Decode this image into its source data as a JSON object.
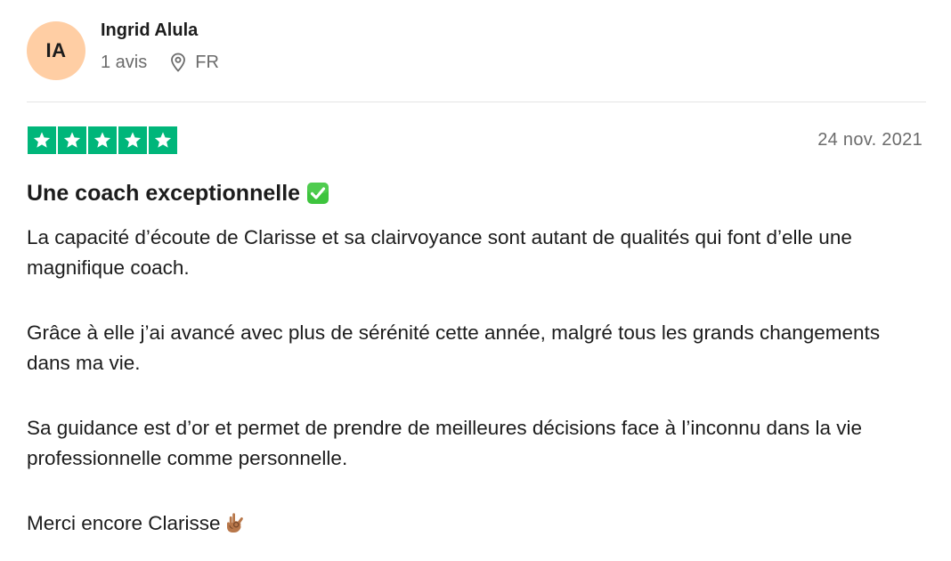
{
  "reviewer": {
    "initials": "IA",
    "avatar_color": "#ffcea4",
    "name": "Ingrid Alula",
    "reviews_count": "1 avis",
    "location_icon": "location-pin-icon",
    "country": "FR"
  },
  "review": {
    "rating": 5,
    "rating_max": 5,
    "star_color": "#00b67a",
    "date": "24 nov. 2021",
    "title": "Une coach exceptionnelle",
    "title_icon": "check-mark-button-icon",
    "paragraphs": [
      "La capacité d’écoute de Clarisse et sa clairvoyance sont autant de qualités qui font d’elle une magnifique coach.",
      "Grâce à elle j’ai avancé avec plus de sérénité cette année, malgré tous les grands changements dans ma vie.",
      "Sa guidance est d’or et permet de prendre de meilleures décisions face à l’inconnu dans la vie professionnelle comme personnelle.",
      "Merci encore Clarisse"
    ],
    "closing_icon": "ok-hand-icon"
  }
}
